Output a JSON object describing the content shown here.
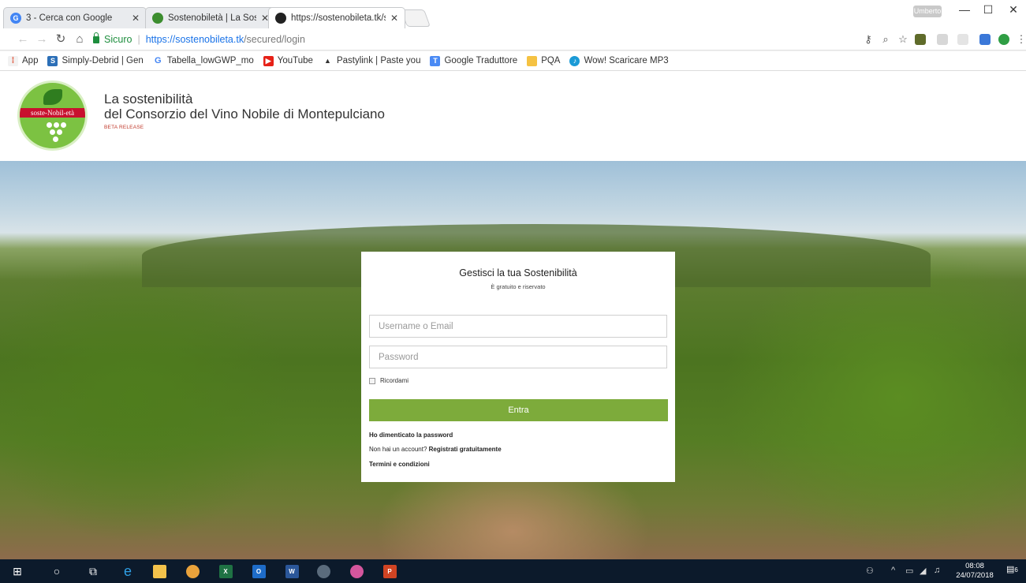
{
  "browser": {
    "tabs": [
      {
        "favicon": "google-icon",
        "label": "3 - Cerca con Google",
        "active": false
      },
      {
        "favicon": "site-globe-icon",
        "label": "Sostenobiletà | La Sosten",
        "active": false
      },
      {
        "favicon": "site-dark-icon",
        "label": "https://sostenobileta.tk/s",
        "active": true
      }
    ],
    "user_badge": "Umberto",
    "controls": {
      "minimize": "—",
      "maximize": "☐",
      "close": "✕"
    },
    "omnibox": {
      "secure_label": "Sicuro",
      "url_scheme": "https://",
      "url_host": "sostenobileta.tk",
      "url_path": "/secured/login"
    },
    "bookmarks": [
      {
        "icon": "apps-grid-icon",
        "label": "App"
      },
      {
        "icon": "simply-debrid-icon",
        "label": "Simply-Debrid | Gen"
      },
      {
        "icon": "google-icon",
        "label": "Tabella_lowGWP_mo"
      },
      {
        "icon": "youtube-icon",
        "label": "YouTube"
      },
      {
        "icon": "pastylink-icon",
        "label": "Pastylink | Paste you"
      },
      {
        "icon": "google-translate-icon",
        "label": "Google Traduttore"
      },
      {
        "icon": "folder-icon",
        "label": "PQA"
      },
      {
        "icon": "music-icon",
        "label": "Wow! Scaricare MP3"
      }
    ]
  },
  "site": {
    "logo_text": "soste-Nobil-età",
    "brand_line1": "La sostenibilità",
    "brand_line2": "del Consorzio del Vino Nobile di Montepulciano",
    "beta_label": "BETA RELEASE"
  },
  "login": {
    "title": "Gestisci la tua Sostenibilità",
    "subtitle": "È gratuito e riservato",
    "username_placeholder": "Username o Email",
    "password_placeholder": "Password",
    "remember_label": "Ricordami",
    "submit_label": "Entra",
    "forgot_label": "Ho dimenticato la password",
    "no_account_label": "Non hai un account?",
    "register_label": "Registrati gratuitamente",
    "terms_label": "Termini e condizioni"
  },
  "taskbar": {
    "time": "08:08",
    "date": "24/07/2018",
    "notifications": "6"
  }
}
